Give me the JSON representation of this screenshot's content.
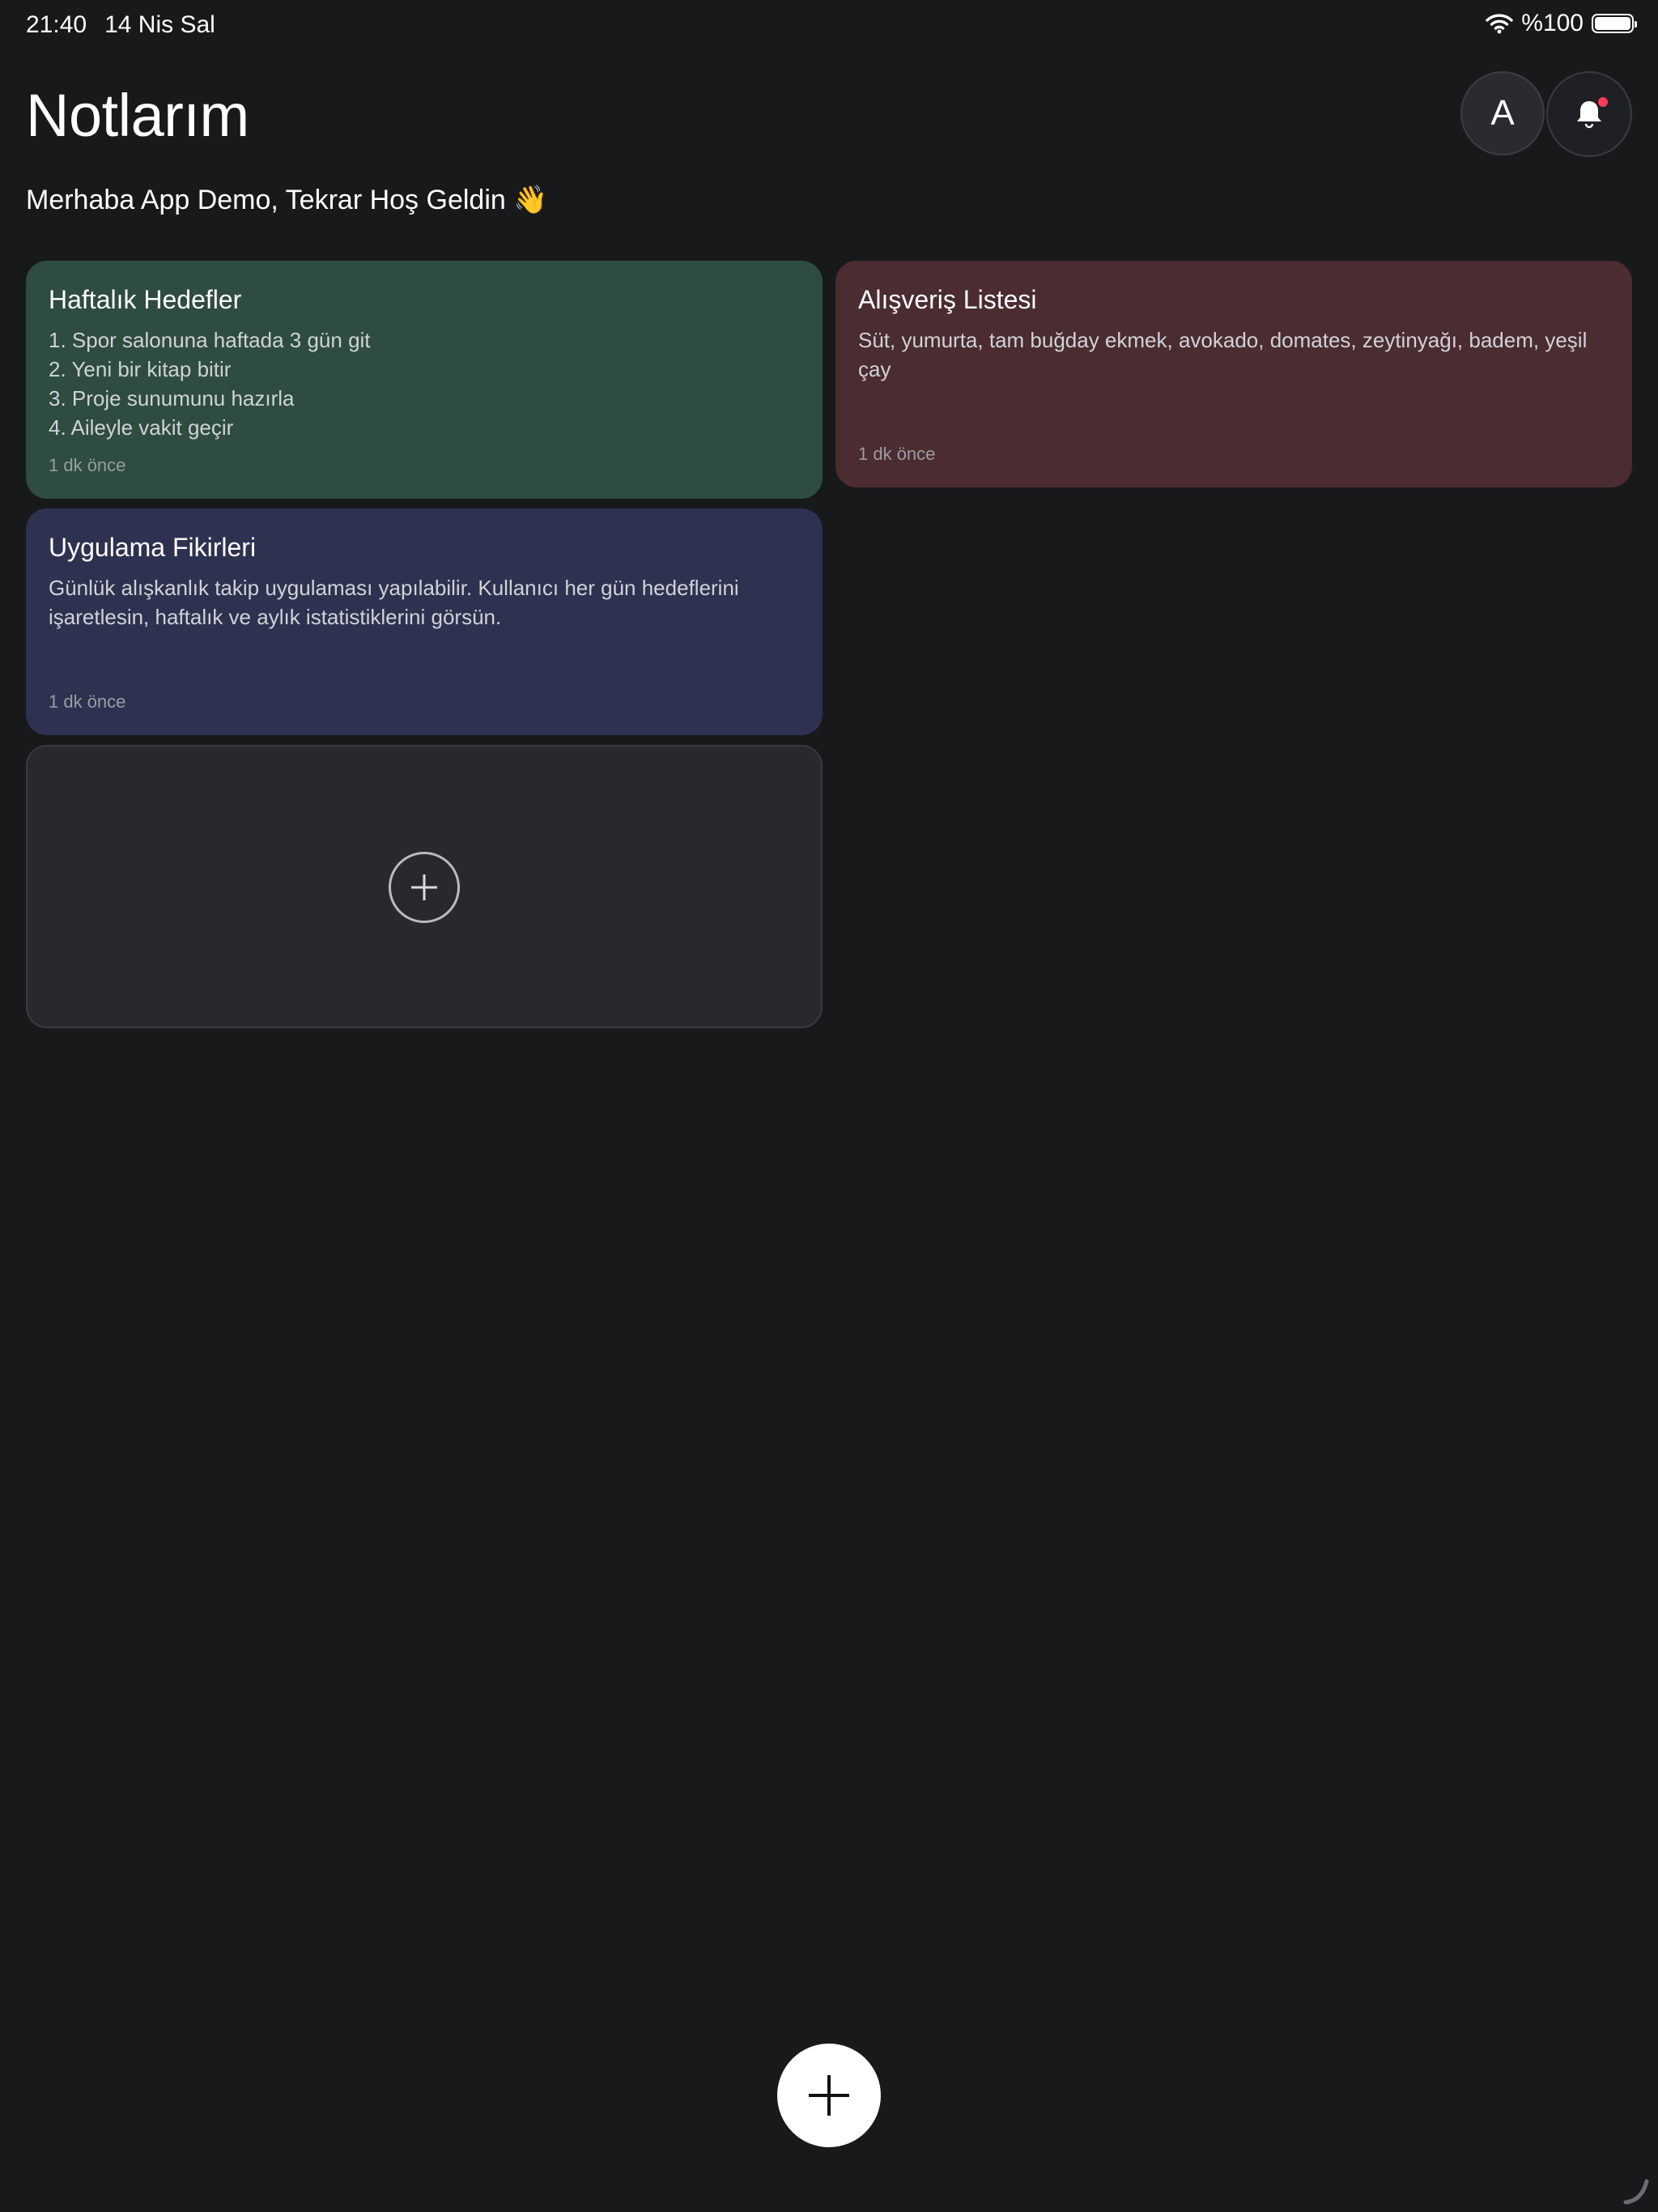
{
  "status_bar": {
    "time": "21:40",
    "date": "14 Nis Sal",
    "battery_text": "%100",
    "battery_level": 1.0
  },
  "header": {
    "title": "Notlarım",
    "greeting": "Merhaba App Demo, Tekrar Hoş Geldin 👋",
    "avatar_letter": "A",
    "notification_badge": true
  },
  "notes": [
    {
      "title": "Haftalık Hedefler",
      "body": "1. Spor salonuna haftada 3 gün git\n2. Yeni bir kitap bitir\n3. Proje sunumunu hazırla\n4. Aileyle vakit geçir",
      "time": "1 dk önce",
      "color": "#2e4c40"
    },
    {
      "title": "Alışveriş Listesi",
      "body": "Süt, yumurta, tam buğday ekmek, avokado, domates, zeytinyağı, badem, yeşil çay",
      "time": "1 dk önce",
      "color": "#4a2c31"
    },
    {
      "title": "Uygulama Fikirleri",
      "body": "Günlük alışkanlık takip uygulaması yapılabilir. Kullanıcı her gün hedeflerini işaretlesin, haftalık ve aylık istatistiklerini görsün.",
      "time": "1 dk önce",
      "color": "#2e3250"
    }
  ],
  "colors": {
    "background": "#18191b",
    "add_card": "#28292d",
    "badge": "#ff3b5c"
  }
}
